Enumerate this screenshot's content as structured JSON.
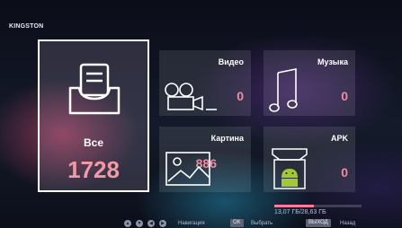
{
  "device_title": "KINGSTON",
  "tiles": {
    "all": {
      "label": "Все",
      "count": "1728",
      "icon": "folder-stack-icon"
    },
    "video": {
      "label": "Видео",
      "count": "0",
      "icon": "video-camera-icon"
    },
    "music": {
      "label": "Музыка",
      "count": "0",
      "icon": "music-note-icon"
    },
    "picture": {
      "label": "Картина",
      "count": "886",
      "icon": "image-icon"
    },
    "apk": {
      "label": "APK",
      "count": "0",
      "icon": "android-package-icon"
    }
  },
  "storage": {
    "text": "13,07 ГБ/28,63 ГБ",
    "used_fraction": 0.456
  },
  "footer": {
    "nav_label": "Навигация",
    "ok_key": "OK",
    "ok_label": "Выбрать",
    "exit_key": "ВЫХОД",
    "exit_label": "Назад"
  },
  "colors": {
    "accent": "#f28ba0",
    "storage_text": "#9ec9ff"
  }
}
